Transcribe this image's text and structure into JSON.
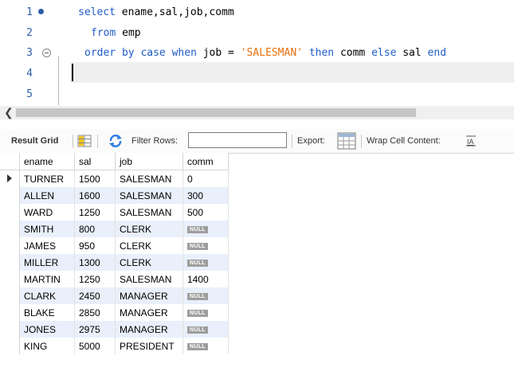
{
  "editor": {
    "line_numbers": [
      "1",
      "2",
      "3",
      "4",
      "5"
    ],
    "line1": {
      "kw": "select",
      "rest": " ename,sal,job,comm"
    },
    "line2": {
      "kw": "from",
      "rest": " emp"
    },
    "line3": {
      "order": "order",
      "by": "by",
      "case": "case",
      "when": "when",
      "job": " job = ",
      "str": "'SALESMAN'",
      "then": "then",
      "comm": " comm ",
      "else": "else",
      "sal": " sal ",
      "end": "end"
    }
  },
  "toolbar": {
    "result_grid": "Result Grid",
    "filter_rows": "Filter Rows:",
    "filter_value": "",
    "export": "Export:",
    "wrap": "Wrap Cell Content:"
  },
  "grid": {
    "columns": [
      "ename",
      "sal",
      "job",
      "comm"
    ],
    "null_label": "NULL",
    "rows": [
      {
        "ename": "TURNER",
        "sal": "1500",
        "job": "SALESMAN",
        "comm": "0"
      },
      {
        "ename": "ALLEN",
        "sal": "1600",
        "job": "SALESMAN",
        "comm": "300"
      },
      {
        "ename": "WARD",
        "sal": "1250",
        "job": "SALESMAN",
        "comm": "500"
      },
      {
        "ename": "SMITH",
        "sal": "800",
        "job": "CLERK",
        "comm": "NULL"
      },
      {
        "ename": "JAMES",
        "sal": "950",
        "job": "CLERK",
        "comm": "NULL"
      },
      {
        "ename": "MILLER",
        "sal": "1300",
        "job": "CLERK",
        "comm": "NULL"
      },
      {
        "ename": "MARTIN",
        "sal": "1250",
        "job": "SALESMAN",
        "comm": "1400"
      },
      {
        "ename": "CLARK",
        "sal": "2450",
        "job": "MANAGER",
        "comm": "NULL"
      },
      {
        "ename": "BLAKE",
        "sal": "2850",
        "job": "MANAGER",
        "comm": "NULL"
      },
      {
        "ename": "JONES",
        "sal": "2975",
        "job": "MANAGER",
        "comm": "NULL"
      },
      {
        "ename": "KING",
        "sal": "5000",
        "job": "PRESIDENT",
        "comm": "NULL"
      }
    ]
  },
  "colors": {
    "keyword": "#1f5bc6",
    "string": "#e6700d",
    "line_number": "#2b5fa7",
    "row_alt": "#e9f0fb"
  },
  "icons": [
    "breakpoint-dot-icon",
    "fold-icon",
    "scroll-left-icon",
    "grid-layout-icon",
    "refresh-icon",
    "export-icon",
    "wrap-cell-icon",
    "current-row-arrow-icon"
  ]
}
